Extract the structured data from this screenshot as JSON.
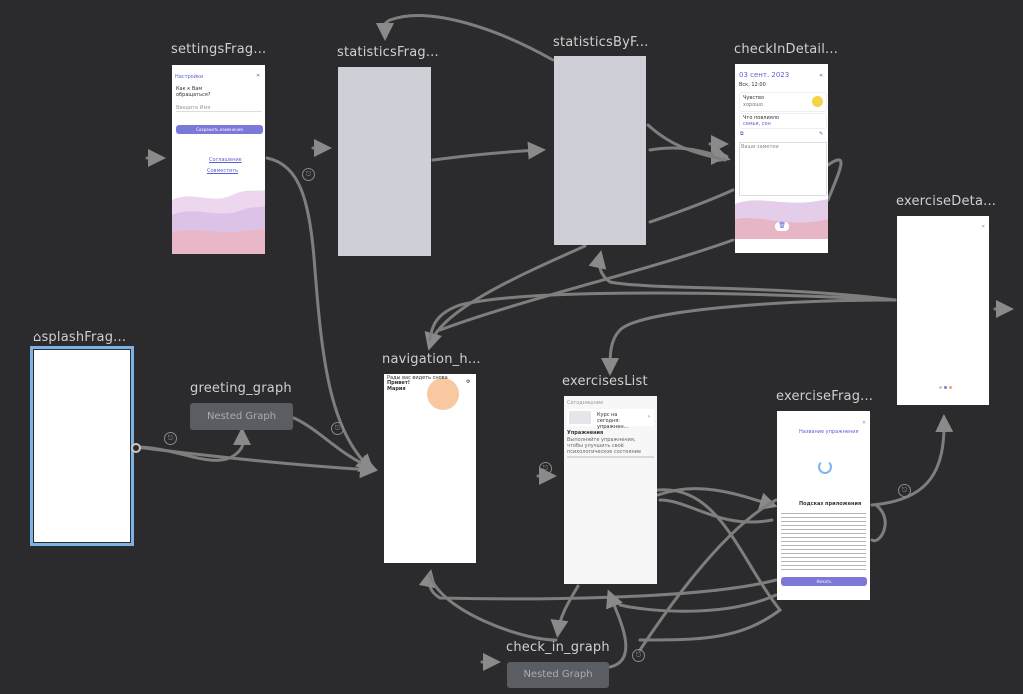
{
  "nodes": {
    "settings": {
      "title": "settingsFrag...",
      "screen": {
        "header": "Настройки",
        "question": "Как к Вам обращаться?",
        "field_placeholder": "Введите Имя",
        "save_button": "Сохранить изменения",
        "link1": "Соглашение",
        "link2": "Совместить"
      }
    },
    "statistics": {
      "title": "statisticsFrag..."
    },
    "statistics_by": {
      "title": "statisticsByF..."
    },
    "checkin_detail": {
      "title": "checkInDetail...",
      "screen": {
        "date": "03 сент. 2023",
        "time": "Вск, 12:00",
        "row1_label": "Чувство",
        "row1_value": "хорошо",
        "row2_label": "Что повлияло",
        "row2_value": "семья, сон",
        "notes_placeholder": "Ваши заметки"
      }
    },
    "exercise_detail": {
      "title": "exerciseDeta..."
    },
    "splash": {
      "title": "splashFrag..."
    },
    "greeting": {
      "title": "greeting_graph",
      "label": "Nested Graph"
    },
    "navigation": {
      "title": "navigation_h...",
      "screen": {
        "line1": "Рады вас видеть снова",
        "line2": "Привет!",
        "line3": "Мария"
      }
    },
    "exercises_list": {
      "title": "exercisesList",
      "screen": {
        "top": "Сегодняшние",
        "card_text": "Курс на сегодня: упражнен...",
        "section": "Упражнения",
        "desc": "Выполняйте упражнения, чтобы улучшить своё психологическое состояние"
      }
    },
    "exercise_frag": {
      "title": "exerciseFrag...",
      "screen": {
        "heading": "Название упражнения",
        "subheading": "Подсказ приложения",
        "button": "Начать"
      }
    },
    "check_in": {
      "title": "check_in_graph",
      "label": "Nested Graph"
    }
  },
  "colors": {
    "background": "#2b2b2d",
    "edge": "#8a8a8a",
    "selection": "#7db2e6",
    "accent": "#7b78d8"
  }
}
